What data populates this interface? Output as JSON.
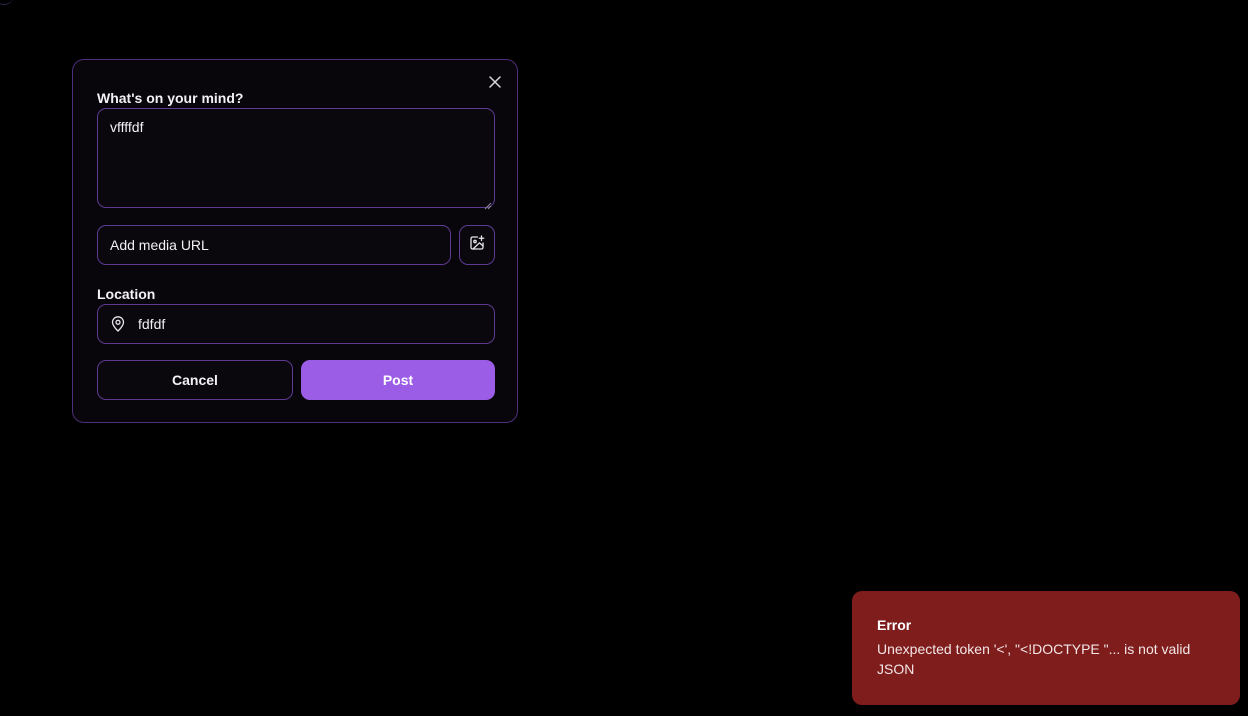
{
  "dialog": {
    "content_label": "What's on your mind?",
    "content_value": "vffffdf",
    "media_placeholder": "Add media URL",
    "location_label": "Location",
    "location_value": "fdfdf",
    "cancel_label": "Cancel",
    "post_label": "Post",
    "icons": {
      "close": "close-icon",
      "media": "image-plus-icon",
      "location": "map-pin-icon"
    }
  },
  "toast": {
    "title": "Error",
    "message": "Unexpected token '<', \"<!DOCTYPE \"... is not valid JSON"
  },
  "colors": {
    "background": "#000000",
    "dialog_border": "#4d2f7a",
    "input_border": "#5e3a93",
    "accent": "#9b5de5",
    "error_bg": "#7f1d1d"
  }
}
